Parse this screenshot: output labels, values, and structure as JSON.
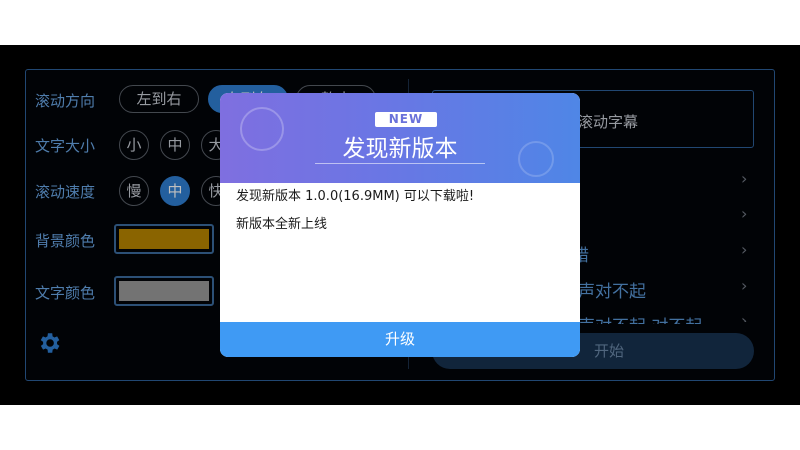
{
  "settings": {
    "direction_label": "滚动方向",
    "direction_options": [
      "左到右",
      "右到左",
      "静止"
    ],
    "size_label": "文字大小",
    "size_options": [
      "小",
      "中",
      "大"
    ],
    "speed_label": "滚动速度",
    "speed_options": [
      "慢",
      "中",
      "快"
    ],
    "bg_color_label": "背景颜色",
    "bg_color": "#b88600",
    "text_color_label": "文字颜色",
    "text_color": "#9a9a9a"
  },
  "preview": {
    "text": "滚动字幕"
  },
  "list": {
    "items": [
      "错",
      "声对不起",
      "声对不起  对不起"
    ]
  },
  "start_button": "开始",
  "dialog": {
    "badge": "NEW",
    "title": "发现新版本",
    "message_line1": "发现新版本 1.0.0(16.9MM) 可以下载啦!",
    "message_line2": "新版本全新上线",
    "upgrade_button": "升级"
  },
  "colors": {
    "accent": "#2f7fd3",
    "dialog_button": "#3f9af4",
    "label_blue": "#6aa7e6"
  }
}
